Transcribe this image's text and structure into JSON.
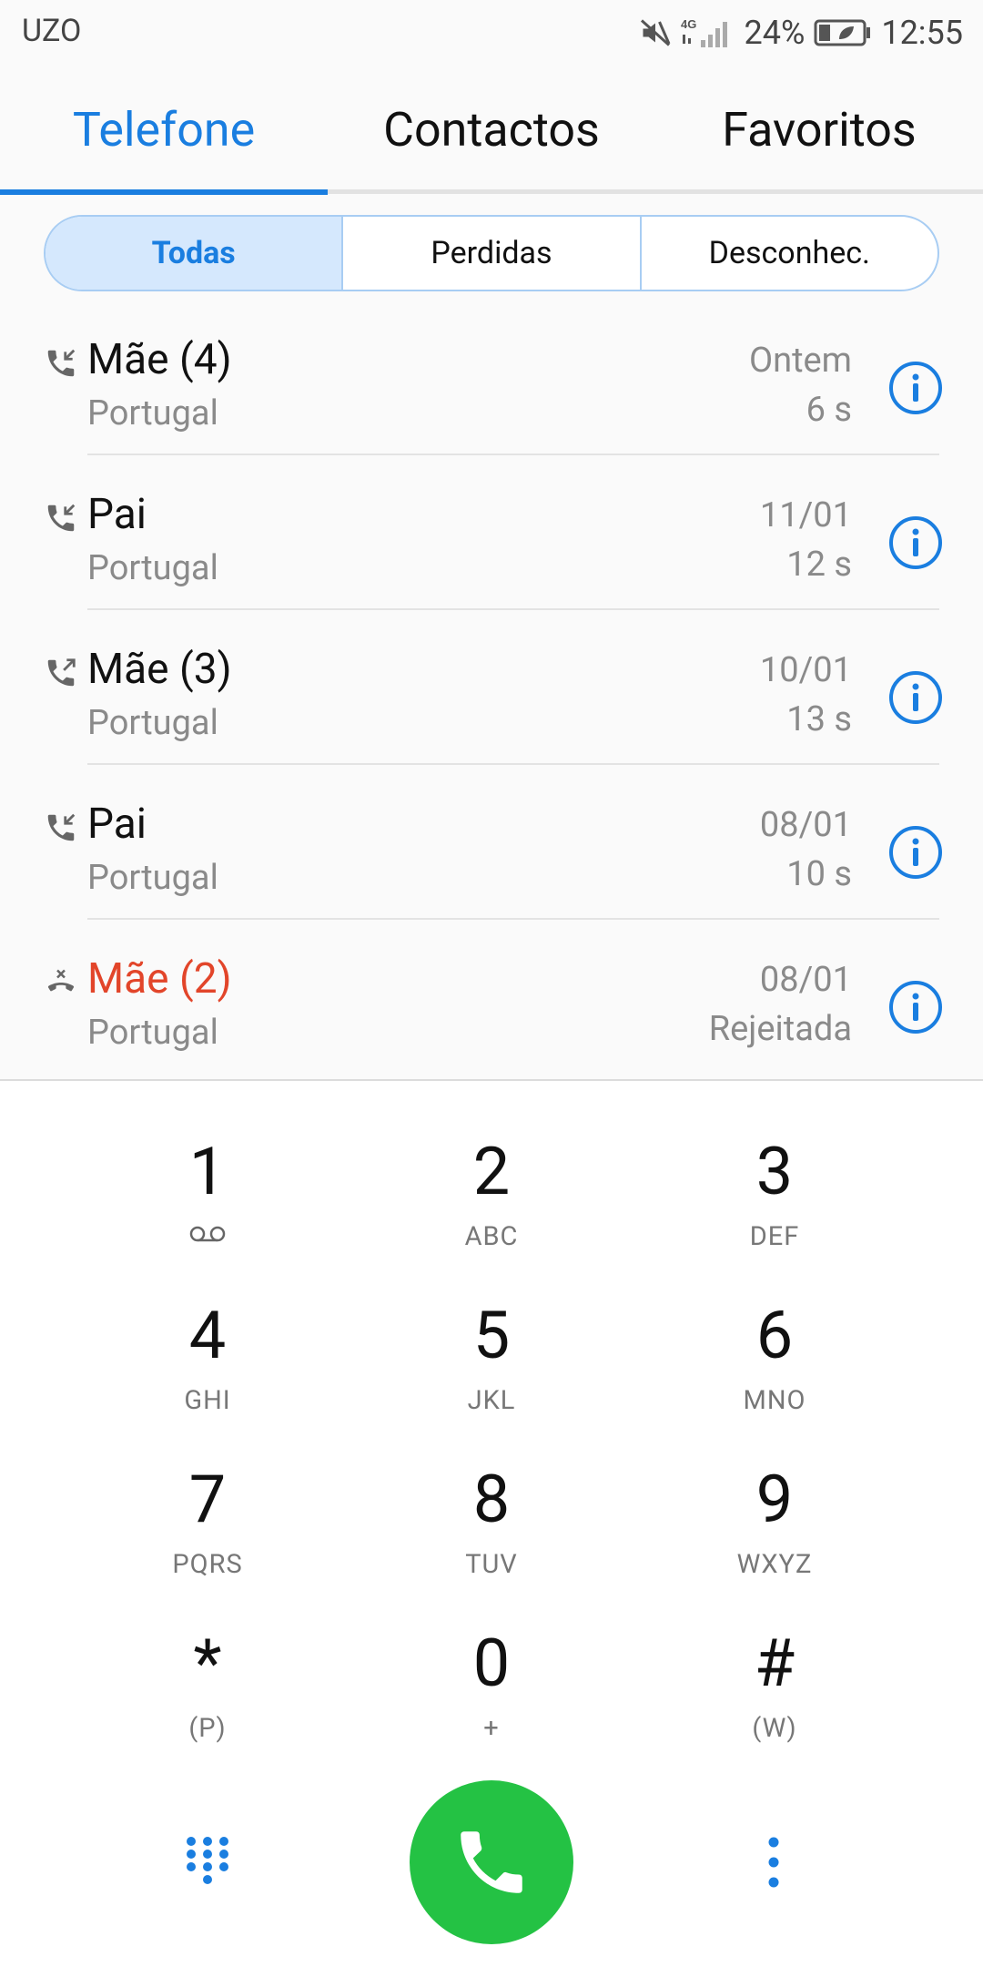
{
  "status_bar": {
    "carrier": "UZO",
    "network": "4G",
    "battery": "24%",
    "time": "12:55",
    "icons": [
      "mute-icon",
      "signal-icon",
      "battery-saver-icon"
    ]
  },
  "tabs": [
    {
      "label": "Telefone",
      "active": true
    },
    {
      "label": "Contactos",
      "active": false
    },
    {
      "label": "Favoritos",
      "active": false
    }
  ],
  "filters": [
    {
      "label": "Todas",
      "active": true
    },
    {
      "label": "Perdidas",
      "active": false
    },
    {
      "label": "Desconhec.",
      "active": false
    }
  ],
  "calls": [
    {
      "name": "Mãe (4)",
      "location": "Portugal",
      "date": "Ontem",
      "detail": "6 s",
      "type": "incoming"
    },
    {
      "name": "Pai",
      "location": "Portugal",
      "date": "11/01",
      "detail": "12 s",
      "type": "incoming"
    },
    {
      "name": "Mãe (3)",
      "location": "Portugal",
      "date": "10/01",
      "detail": "13 s",
      "type": "outgoing"
    },
    {
      "name": "Pai",
      "location": "Portugal",
      "date": "08/01",
      "detail": "10 s",
      "type": "incoming"
    },
    {
      "name": "Mãe (2)",
      "location": "Portugal",
      "date": "08/01",
      "detail": "Rejeitada",
      "type": "rejected"
    }
  ],
  "dialpad": [
    {
      "digit": "1",
      "letters": "",
      "icon": "voicemail-icon"
    },
    {
      "digit": "2",
      "letters": "ABC"
    },
    {
      "digit": "3",
      "letters": "DEF"
    },
    {
      "digit": "4",
      "letters": "GHI"
    },
    {
      "digit": "5",
      "letters": "JKL"
    },
    {
      "digit": "6",
      "letters": "MNO"
    },
    {
      "digit": "7",
      "letters": "PQRS"
    },
    {
      "digit": "8",
      "letters": "TUV"
    },
    {
      "digit": "9",
      "letters": "WXYZ"
    },
    {
      "digit": "*",
      "letters": "(P)"
    },
    {
      "digit": "0",
      "letters": "+"
    },
    {
      "digit": "#",
      "letters": "(W)"
    }
  ],
  "colors": {
    "accent": "#1a7ee0",
    "missed": "#e2452a",
    "call_button": "#24c244"
  }
}
